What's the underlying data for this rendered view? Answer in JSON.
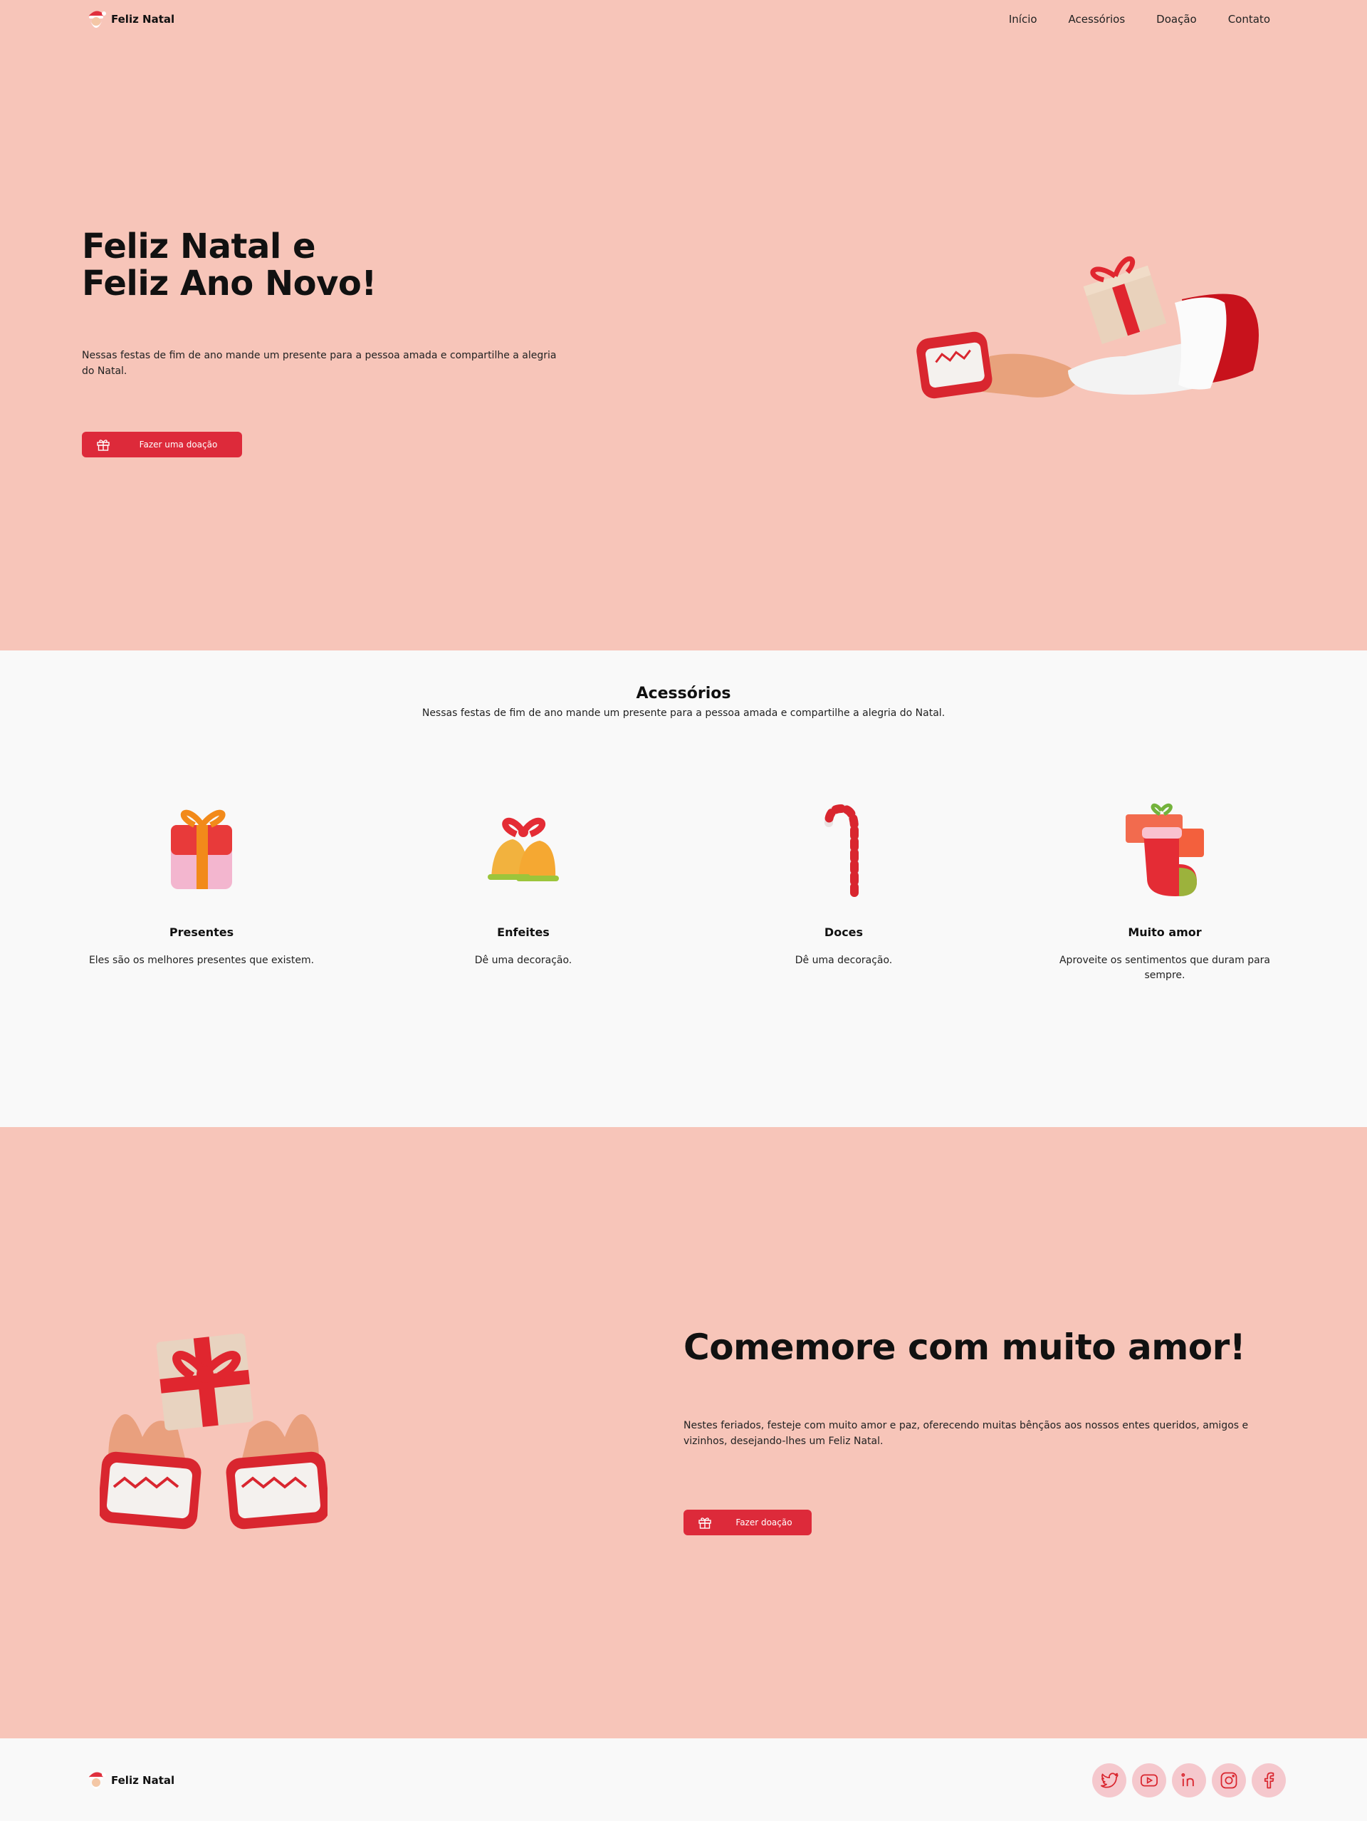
{
  "brand": {
    "name": "Feliz Natal"
  },
  "nav": {
    "items": [
      "Início",
      "Acessórios",
      "Doação",
      "Contato"
    ]
  },
  "hero": {
    "title_line1": "Feliz Natal e",
    "title_line2": "Feliz Ano Novo!",
    "text": "Nessas festas de fim de ano mande um presente para a pessoa amada e compartilhe a alegria do Natal.",
    "button_label": "Fazer uma doação",
    "button_icon": "gift-icon"
  },
  "accessories": {
    "title": "Acessórios",
    "subtitle": "Nessas festas de fim de ano mande um presente para a pessoa amada e compartilhe a alegria do Natal.",
    "cards": [
      {
        "icon": "gift-box-icon",
        "title": "Presentes",
        "text": "Eles são os melhores presentes que existem."
      },
      {
        "icon": "bells-icon",
        "title": "Enfeites",
        "text": "Dê uma decoração."
      },
      {
        "icon": "candy-cane-icon",
        "title": "Doces",
        "text": "Dê uma decoração."
      },
      {
        "icon": "stocking-icon",
        "title": "Muito amor",
        "text": "Aproveite os sentimentos que duram para sempre."
      }
    ]
  },
  "celebrate": {
    "title": "Comemore com muito amor!",
    "text": "Nestes feriados, festeje com muito amor e paz, oferecendo muitas bênçãos aos nossos entes queridos, amigos e vizinhos, desejando-lhes um Feliz Natal.",
    "button_label": "Fazer doação"
  },
  "footer": {
    "brand": "Feliz Natal",
    "socials": [
      "twitter-icon",
      "youtube-icon",
      "linkedin-icon",
      "instagram-icon",
      "facebook-icon"
    ]
  },
  "colors": {
    "pink_bg": "#f7c5b9",
    "accent_red": "#dd2a3a",
    "light_bg": "#f9f9f9",
    "social_bg": "#f5c8cd"
  }
}
